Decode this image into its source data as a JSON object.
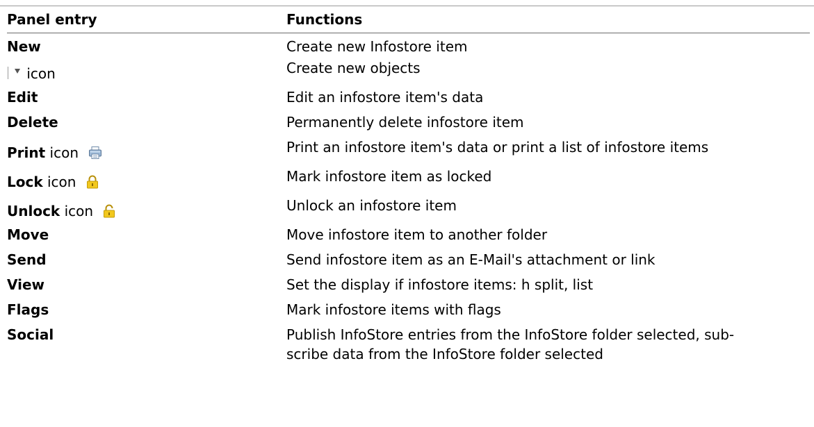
{
  "header": {
    "col_entry": "Panel entry",
    "col_functions": "Functions"
  },
  "rows": [
    {
      "entry": "New",
      "suffix": "",
      "icon": "",
      "function": "Create new Infostore item"
    },
    {
      "entry": "",
      "suffix": "icon",
      "icon": "dropdown-arrow-icon",
      "function": "Create new objects"
    },
    {
      "entry": "Edit",
      "suffix": "",
      "icon": "",
      "function": "Edit an infostore item's data"
    },
    {
      "entry": "Delete",
      "suffix": "",
      "icon": "",
      "function": "Permanently delete infostore item"
    },
    {
      "entry": "Print",
      "suffix": "icon",
      "icon": "printer-icon",
      "function": "Print an infostore item's data or print a list of infostore items"
    },
    {
      "entry": "Lock",
      "suffix": "icon",
      "icon": "lock-icon",
      "function": "Mark infostore item as locked"
    },
    {
      "entry": "Unlock",
      "suffix": "icon",
      "icon": "unlock-icon",
      "function": "Unlock an infostore item"
    },
    {
      "entry": "Move",
      "suffix": "",
      "icon": "",
      "function": "Move infostore item to another folder"
    },
    {
      "entry": "Send",
      "suffix": "",
      "icon": "",
      "function": "Send infostore item as an E-Mail's attachment or link"
    },
    {
      "entry": "View",
      "suffix": "",
      "icon": "",
      "function": "Set the display if infostore items: h split, list"
    },
    {
      "entry": "Flags",
      "suffix": "",
      "icon": "",
      "function": "Mark infostore items with flags"
    },
    {
      "entry": "Social",
      "suffix": "",
      "icon": "",
      "function_line1": "Publish InfoStore entries from the InfoStore folder selected, sub-",
      "function_line2": "scribe data from the InfoStore folder selected"
    }
  ]
}
